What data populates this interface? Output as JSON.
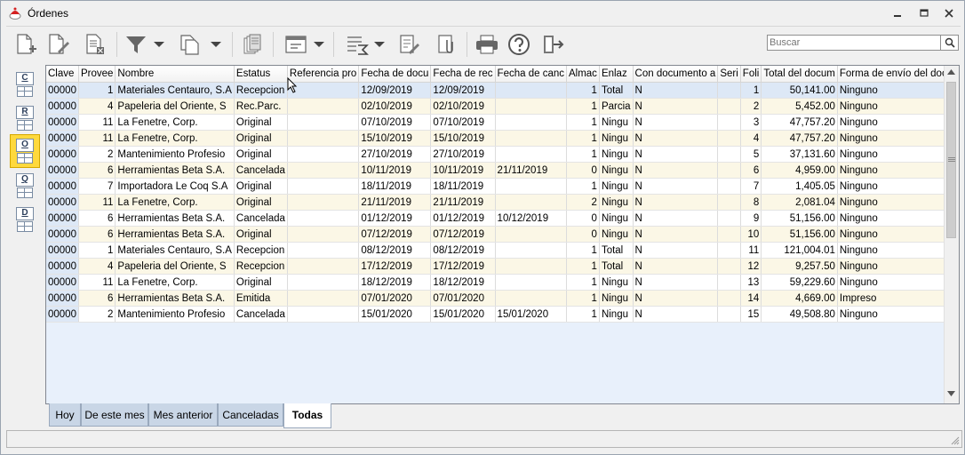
{
  "window": {
    "title": "Órdenes"
  },
  "search": {
    "placeholder": "Buscar"
  },
  "sidebar": {
    "buttons": [
      {
        "letter": "C"
      },
      {
        "letter": "R"
      },
      {
        "letter": "O"
      },
      {
        "letter": "Q"
      },
      {
        "letter": "D"
      }
    ]
  },
  "grid": {
    "columns": [
      "Clave",
      "Provee",
      "Nombre",
      "Estatus",
      "Referencia pro",
      "Fecha de docu",
      "Fecha de rec",
      "Fecha de canc",
      "Almac",
      "Enlaz",
      "Con documento a",
      "Seri",
      "Foli",
      "Total del docum",
      "Forma de envío del documento"
    ],
    "rows": [
      [
        "00000",
        "1",
        "Materiales Centauro, S.A",
        "Recepcion",
        "",
        "12/09/2019",
        "12/09/2019",
        "",
        "1",
        "Total",
        "N",
        "",
        "1",
        "50,141.00",
        "Ninguno"
      ],
      [
        "00000",
        "4",
        "Papeleria del Oriente, S",
        "Rec.Parc.",
        "",
        "02/10/2019",
        "02/10/2019",
        "",
        "1",
        "Parcia",
        "N",
        "",
        "2",
        "5,452.00",
        "Ninguno"
      ],
      [
        "00000",
        "11",
        "La Fenetre, Corp.",
        "Original",
        "",
        "07/10/2019",
        "07/10/2019",
        "",
        "1",
        "Ningu",
        "N",
        "",
        "3",
        "47,757.20",
        "Ninguno"
      ],
      [
        "00000",
        "11",
        "La Fenetre, Corp.",
        "Original",
        "",
        "15/10/2019",
        "15/10/2019",
        "",
        "1",
        "Ningu",
        "N",
        "",
        "4",
        "47,757.20",
        "Ninguno"
      ],
      [
        "00000",
        "2",
        "Mantenimiento Profesio",
        "Original",
        "",
        "27/10/2019",
        "27/10/2019",
        "",
        "1",
        "Ningu",
        "N",
        "",
        "5",
        "37,131.60",
        "Ninguno"
      ],
      [
        "00000",
        "6",
        "Herramientas Beta S.A.",
        "Cancelada",
        "",
        "10/11/2019",
        "10/11/2019",
        "21/11/2019",
        "0",
        "Ningu",
        "N",
        "",
        "6",
        "4,959.00",
        "Ninguno"
      ],
      [
        "00000",
        "7",
        "Importadora Le Coq S.A",
        "Original",
        "",
        "18/11/2019",
        "18/11/2019",
        "",
        "1",
        "Ningu",
        "N",
        "",
        "7",
        "1,405.05",
        "Ninguno"
      ],
      [
        "00000",
        "11",
        "La Fenetre, Corp.",
        "Original",
        "",
        "21/11/2019",
        "21/11/2019",
        "",
        "2",
        "Ningu",
        "N",
        "",
        "8",
        "2,081.04",
        "Ninguno"
      ],
      [
        "00000",
        "6",
        "Herramientas Beta S.A.",
        "Cancelada",
        "",
        "01/12/2019",
        "01/12/2019",
        "10/12/2019",
        "0",
        "Ningu",
        "N",
        "",
        "9",
        "51,156.00",
        "Ninguno"
      ],
      [
        "00000",
        "6",
        "Herramientas Beta S.A.",
        "Original",
        "",
        "07/12/2019",
        "07/12/2019",
        "",
        "0",
        "Ningu",
        "N",
        "",
        "10",
        "51,156.00",
        "Ninguno"
      ],
      [
        "00000",
        "1",
        "Materiales Centauro, S.A",
        "Recepcion",
        "",
        "08/12/2019",
        "08/12/2019",
        "",
        "1",
        "Total",
        "N",
        "",
        "11",
        "121,004.01",
        "Ninguno"
      ],
      [
        "00000",
        "4",
        "Papeleria del Oriente, S",
        "Recepcion",
        "",
        "17/12/2019",
        "17/12/2019",
        "",
        "1",
        "Total",
        "N",
        "",
        "12",
        "9,257.50",
        "Ninguno"
      ],
      [
        "00000",
        "11",
        "La Fenetre, Corp.",
        "Original",
        "",
        "18/12/2019",
        "18/12/2019",
        "",
        "1",
        "Ningu",
        "N",
        "",
        "13",
        "59,229.60",
        "Ninguno"
      ],
      [
        "00000",
        "6",
        "Herramientas Beta S.A.",
        "Emitida",
        "",
        "07/01/2020",
        "07/01/2020",
        "",
        "1",
        "Ningu",
        "N",
        "",
        "14",
        "4,669.00",
        "Impreso"
      ],
      [
        "00000",
        "2",
        "Mantenimiento Profesio",
        "Cancelada",
        "",
        "15/01/2020",
        "15/01/2020",
        "15/01/2020",
        "1",
        "Ningu",
        "N",
        "",
        "15",
        "49,508.80",
        "Ninguno"
      ]
    ]
  },
  "tabs": [
    {
      "label": "Hoy"
    },
    {
      "label": "De este mes"
    },
    {
      "label": "Mes anterior"
    },
    {
      "label": "Canceladas"
    },
    {
      "label": "Todas"
    }
  ],
  "colors": {
    "selected_row": "#dde8f6",
    "alt_row": "#fbf7e6",
    "active_side": "#ffd93d",
    "tab_bg": "#c9d6e6"
  }
}
